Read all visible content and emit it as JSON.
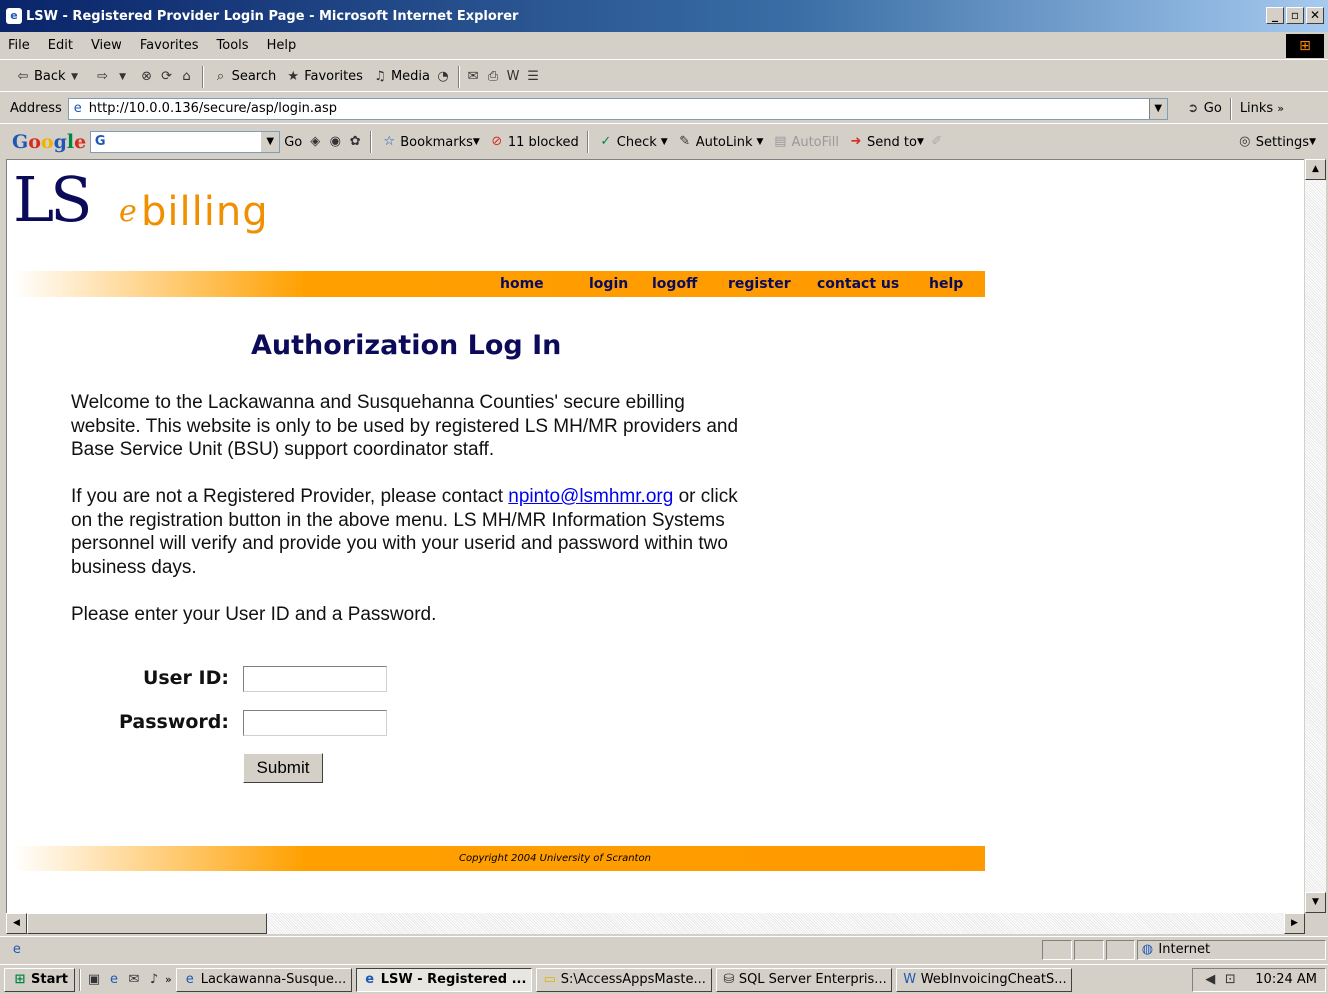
{
  "window": {
    "title": "LSW - Registered Provider Login Page - Microsoft Internet Explorer",
    "controls": [
      "_",
      "▫",
      "✕"
    ]
  },
  "menubar": [
    "File",
    "Edit",
    "View",
    "Favorites",
    "Tools",
    "Help"
  ],
  "toolbar": {
    "back": "Back",
    "search": "Search",
    "favorites": "Favorites",
    "media": "Media"
  },
  "address": {
    "label": "Address",
    "url": "http://10.0.0.136/secure/asp/login.asp",
    "go": "Go",
    "links": "Links"
  },
  "googlebar": {
    "logo": "Google",
    "go": "Go",
    "bookmarks": "Bookmarks",
    "blocked": "11 blocked",
    "check": "Check",
    "autolink": "AutoLink",
    "autofill": "AutoFill",
    "sendto": "Send to",
    "settings": "Settings"
  },
  "page": {
    "logo_ls": "LS",
    "logo_e": "e",
    "logo_billing": "billing",
    "nav": [
      "home",
      "login",
      "logoff",
      "register",
      "contact us",
      "help"
    ],
    "heading": "Authorization Log In",
    "para1": "Welcome to the Lackawanna and Susquehanna Counties' secure ebilling website. This website is only to be used by registered LS MH/MR providers and Base Service Unit (BSU) support coordinator staff.",
    "para2_before": "If you are not a Registered Provider, please contact ",
    "para2_email": "npinto@lsmhmr.org",
    "para2_after": " or click on the registration button in the above menu.   LS MH/MR Information Systems personnel will verify and provide you with your userid and password within two business days.",
    "para3": "Please enter your User ID and a Password.",
    "userid_label": "User ID:",
    "password_label": "Password:",
    "userid_value": "",
    "password_value": "",
    "submit": "Submit",
    "copyright": "Copyright 2004  University of Scranton"
  },
  "statusbar": {
    "zone": "Internet"
  },
  "taskbar": {
    "start": "Start",
    "tasks": [
      "Lackawanna-Susque...",
      "LSW - Registered ...",
      "S:\\AccessAppsMaste...",
      "SQL Server Enterpris...",
      "WebInvoicingCheatS..."
    ],
    "clock": "10:24 AM"
  }
}
